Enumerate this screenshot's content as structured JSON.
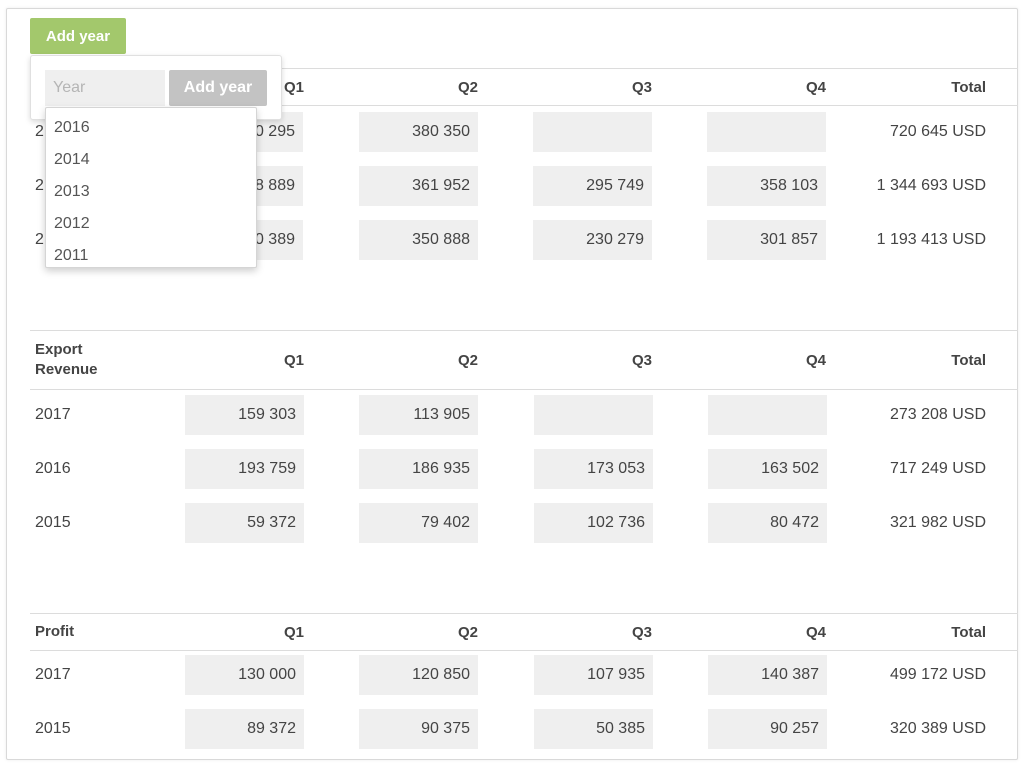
{
  "toolbar": {
    "add_year_label": "Add year"
  },
  "popover": {
    "year_placeholder": "Year",
    "add_year_label": "Add year"
  },
  "dropdown": {
    "options": [
      "2016",
      "2014",
      "2013",
      "2012",
      "2011"
    ]
  },
  "sections": [
    {
      "label": "",
      "columns": [
        "Q1",
        "Q2",
        "Q3",
        "Q4",
        "Total"
      ],
      "rows": [
        {
          "year": "2",
          "q1": "0 295",
          "q2": "380 350",
          "q3": "",
          "q4": "",
          "total": "720 645 USD"
        },
        {
          "year": "2",
          "q1": "8 889",
          "q2": "361 952",
          "q3": "295 749",
          "q4": "358 103",
          "total": "1 344 693 USD"
        },
        {
          "year": "2",
          "q1": "0 389",
          "q2": "350 888",
          "q3": "230 279",
          "q4": "301 857",
          "total": "1 193 413 USD"
        }
      ]
    },
    {
      "label": "Export Revenue",
      "columns": [
        "Q1",
        "Q2",
        "Q3",
        "Q4",
        "Total"
      ],
      "rows": [
        {
          "year": "2017",
          "q1": "159 303",
          "q2": "113 905",
          "q3": "",
          "q4": "",
          "total": "273 208 USD"
        },
        {
          "year": "2016",
          "q1": "193 759",
          "q2": "186 935",
          "q3": "173 053",
          "q4": "163 502",
          "total": "717 249 USD"
        },
        {
          "year": "2015",
          "q1": "59 372",
          "q2": "79 402",
          "q3": "102 736",
          "q4": "80 472",
          "total": "321 982 USD"
        }
      ]
    },
    {
      "label": "Profit",
      "columns": [
        "Q1",
        "Q2",
        "Q3",
        "Q4",
        "Total"
      ],
      "rows": [
        {
          "year": "2017",
          "q1": "130 000",
          "q2": "120 850",
          "q3": "107 935",
          "q4": "140 387",
          "total": "499 172 USD"
        },
        {
          "year": "2015",
          "q1": "89 372",
          "q2": "90 375",
          "q3": "50 385",
          "q4": "90 257",
          "total": "320 389 USD"
        }
      ]
    }
  ]
}
